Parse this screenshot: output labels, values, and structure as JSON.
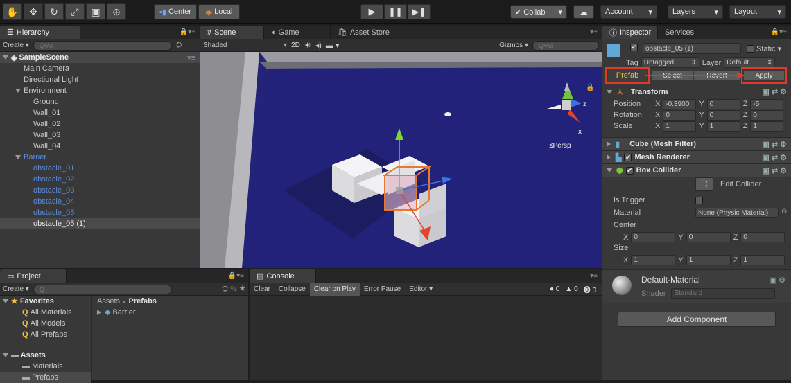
{
  "toolbar": {
    "tools": [
      "hand-tool",
      "move-tool",
      "rotate-tool",
      "scale-tool",
      "rect-tool",
      "transform-tool"
    ],
    "pivot_label": "Center",
    "space_label": "Local",
    "collab_label": "Collab",
    "account_label": "Account",
    "layers_label": "Layers",
    "layout_label": "Layout"
  },
  "hierarchy": {
    "tab": "Hierarchy",
    "create": "Create",
    "search_placeholder": "Q•All",
    "scene": "SampleScene",
    "items": [
      {
        "label": "Main Camera",
        "indent": 1,
        "style": "normal"
      },
      {
        "label": "Directional Light",
        "indent": 1,
        "style": "normal"
      },
      {
        "label": "Environment",
        "indent": 1,
        "style": "folder"
      },
      {
        "label": "Ground",
        "indent": 2,
        "style": "normal"
      },
      {
        "label": "Wall_01",
        "indent": 2,
        "style": "normal"
      },
      {
        "label": "Wall_02",
        "indent": 2,
        "style": "normal"
      },
      {
        "label": "Wall_03",
        "indent": 2,
        "style": "normal"
      },
      {
        "label": "Wall_04",
        "indent": 2,
        "style": "normal"
      },
      {
        "label": "Barrier",
        "indent": 1,
        "style": "prefab-folder"
      },
      {
        "label": "obstacle_01",
        "indent": 2,
        "style": "prefab"
      },
      {
        "label": "obstacle_02",
        "indent": 2,
        "style": "prefab"
      },
      {
        "label": "obstacle_03",
        "indent": 2,
        "style": "prefab"
      },
      {
        "label": "obstacle_04",
        "indent": 2,
        "style": "prefab"
      },
      {
        "label": "obstacle_05",
        "indent": 2,
        "style": "prefab"
      },
      {
        "label": "obstacle_05 (1)",
        "indent": 2,
        "style": "selected"
      }
    ]
  },
  "scene": {
    "tabs": [
      "Scene",
      "Game",
      "Asset Store"
    ],
    "shading": "Shaded",
    "mode_2d": "2D",
    "gizmos": "Gizmos",
    "search_placeholder": "Q•All",
    "persp": "≤Persp",
    "axis_x": "x",
    "axis_z": "z"
  },
  "project": {
    "tab": "Project",
    "create": "Create",
    "favorites": "Favorites",
    "favorite_items": [
      "All Materials",
      "All Models",
      "All Prefabs"
    ],
    "assets": "Assets",
    "asset_items": [
      "Materials",
      "Prefabs"
    ],
    "breadcrumb_root": "Assets",
    "breadcrumb_sep": "▸",
    "breadcrumb_leaf": "Prefabs",
    "content_items": [
      "Barrier"
    ]
  },
  "console": {
    "tab": "Console",
    "buttons": [
      "Clear",
      "Collapse",
      "Clear on Play",
      "Error Pause",
      "Editor"
    ],
    "counts": [
      "0",
      "0",
      "0"
    ]
  },
  "inspector": {
    "tabs": [
      "Inspector",
      "Services"
    ],
    "object_name": "obstacle_05 (1)",
    "static_label": "Static",
    "tag_label": "Tag",
    "tag_value": "Untagged",
    "layer_label": "Layer",
    "layer_value": "Default",
    "prefab_label": "Prefab",
    "select_label": "Select",
    "revert_label": "Revert",
    "apply_label": "Apply",
    "transform": {
      "title": "Transform",
      "rows": [
        {
          "label": "Position",
          "x": "-0.3900",
          "y": "0",
          "z": "-5"
        },
        {
          "label": "Rotation",
          "x": "0",
          "y": "0",
          "z": "0"
        },
        {
          "label": "Scale",
          "x": "1",
          "y": "1",
          "z": "1"
        }
      ]
    },
    "components": [
      "Cube (Mesh Filter)",
      "Mesh Renderer",
      "Box Collider"
    ],
    "edit_collider": "Edit Collider",
    "is_trigger": "Is Trigger",
    "material_label": "Material",
    "material_value": "None (Physic Material)",
    "center_label": "Center",
    "center": {
      "x": "0",
      "y": "0",
      "z": "0"
    },
    "size_label": "Size",
    "size": {
      "x": "1",
      "y": "1",
      "z": "1"
    },
    "default_material": "Default-Material",
    "shader_label": "Shader",
    "shader_value": "Standard",
    "add_component": "Add Component"
  }
}
